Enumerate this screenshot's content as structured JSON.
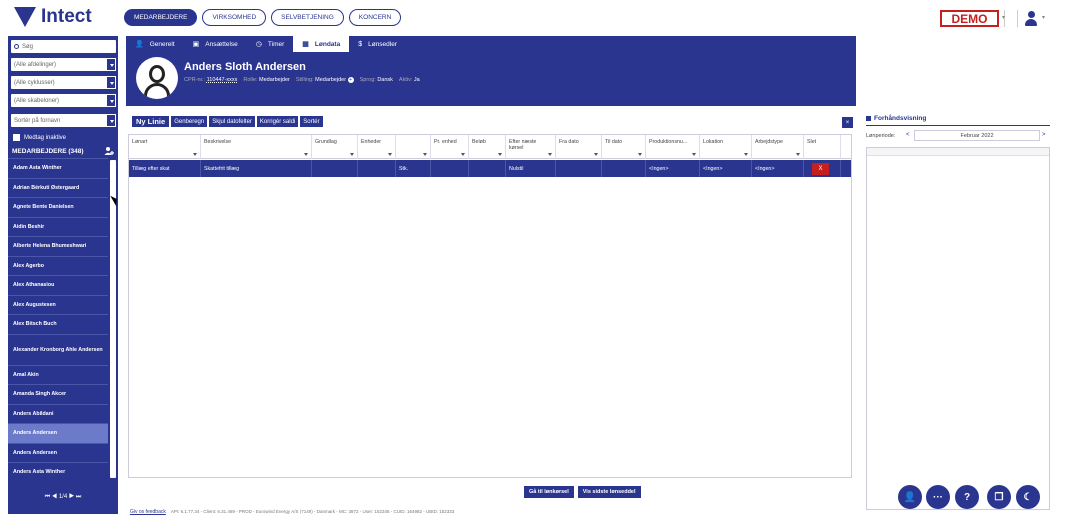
{
  "header": {
    "logo": "Intect",
    "nav": [
      "MEDARBEJDERE",
      "VIRKSOMHED",
      "SELVBETJENING",
      "KONCERN"
    ],
    "demo": "DEMO",
    "caret": "▾"
  },
  "sidebar": {
    "search_placeholder": "Søg",
    "filters": [
      "(Alle afdelinger)",
      "(Alle cyklusser)",
      "(Alle skabeloner)",
      "Sortér på fornavn"
    ],
    "include_inactive": "Medtag inaktive",
    "heading": "MEDARBEJDERE (348)",
    "employees": [
      "Adam Asta Winther",
      "Adrian Bérkuti Østergaard",
      "Agnete Bente Danielsen",
      "Aidin Beshir",
      "Alberte Helena Bhumeshwari",
      "Alex Agerbo",
      "Alex Athanasiou",
      "Alex Augustesen",
      "Alex Bitsch Buch",
      "Alexander Kronborg Ahle Andersen",
      "Amal Akin",
      "Amanda Singh Akcer",
      "Anders Abildani",
      "Anders Andersen",
      "Anders Andersen",
      "Anders Asta Winther"
    ],
    "selected_index": 13,
    "pager": "⏮  ◀  1/4  ▶  ⏭"
  },
  "tabs": [
    {
      "label": "Generelt",
      "icon": "user-icon",
      "glyph": "👤"
    },
    {
      "label": "Ansættelse",
      "icon": "contract-icon",
      "glyph": "▣"
    },
    {
      "label": "Timer",
      "icon": "clock-icon",
      "glyph": "◷"
    },
    {
      "label": "Løndata",
      "icon": "table-icon",
      "glyph": "▦"
    },
    {
      "label": "Lønsedler",
      "icon": "dollar-icon",
      "glyph": "$"
    }
  ],
  "active_tab": 3,
  "employee": {
    "name": "Anders Sloth Andersen",
    "cpr_label": "CPR-nr.:",
    "cpr": "110447-xxxx",
    "role_label": "Rolle:",
    "role": "Medarbejder",
    "position_label": "Stilling:",
    "position": "Medarbejder",
    "language_label": "Sprog:",
    "language": "Dansk",
    "active_label": "Aktiv:",
    "active": "Ja"
  },
  "toolbar": {
    "new_line": "Ny Linie",
    "recalc": "Genberegn",
    "hide_dates": "Skjul datofelter",
    "correct_balances": "Korrigér saldi",
    "sort": "Sortér",
    "close": "×"
  },
  "grid": {
    "columns": [
      "Lønart",
      "Beskrivelse",
      "Grundlag",
      "Enheder",
      "",
      "Pr. enhed",
      "Beløb",
      "Efter næste kørsel",
      "Fra dato",
      "Til dato",
      "Produktionsnu...",
      "Lokation",
      "Arbejdstype",
      "Slet"
    ],
    "rows": [
      [
        "Tillæg efter skat",
        "Skattefrit tillæg",
        "",
        "",
        "Stk.",
        "",
        "",
        "Nulstil",
        "",
        "",
        "<Ingen>",
        "<Ingen>",
        "<Ingen>",
        "X"
      ]
    ]
  },
  "preview": {
    "title": "Forhåndsvisning",
    "period_label": "Lønperiode:",
    "period": "Februar 2022",
    "prev": "<",
    "next": ">"
  },
  "bottom_buttons": {
    "go_to_payroll": "Gå til lønkørsel",
    "show_last_payslip": "Vis sidste lønseddel"
  },
  "footer": {
    "feedback": "Giv os feedback",
    "info": "API: 6.1.77.34 - Client: 6.31.469 - PROD - Eurowind Energy A/S (7149) - Danmark - MC: 3872 - User: 152346 - CUID: 164982 - UBID: 152333"
  },
  "fabs": [
    {
      "icon": "add-user-icon",
      "glyph": "👤"
    },
    {
      "icon": "more-icon",
      "glyph": "···"
    },
    {
      "icon": "help-icon",
      "glyph": "?"
    },
    {
      "icon": "copy-icon",
      "glyph": "❐"
    },
    {
      "icon": "moon-icon",
      "glyph": "☾"
    }
  ],
  "colors": {
    "primary": "#2a3590",
    "danger": "#c42020",
    "selected_row": "#6b7bc9"
  }
}
